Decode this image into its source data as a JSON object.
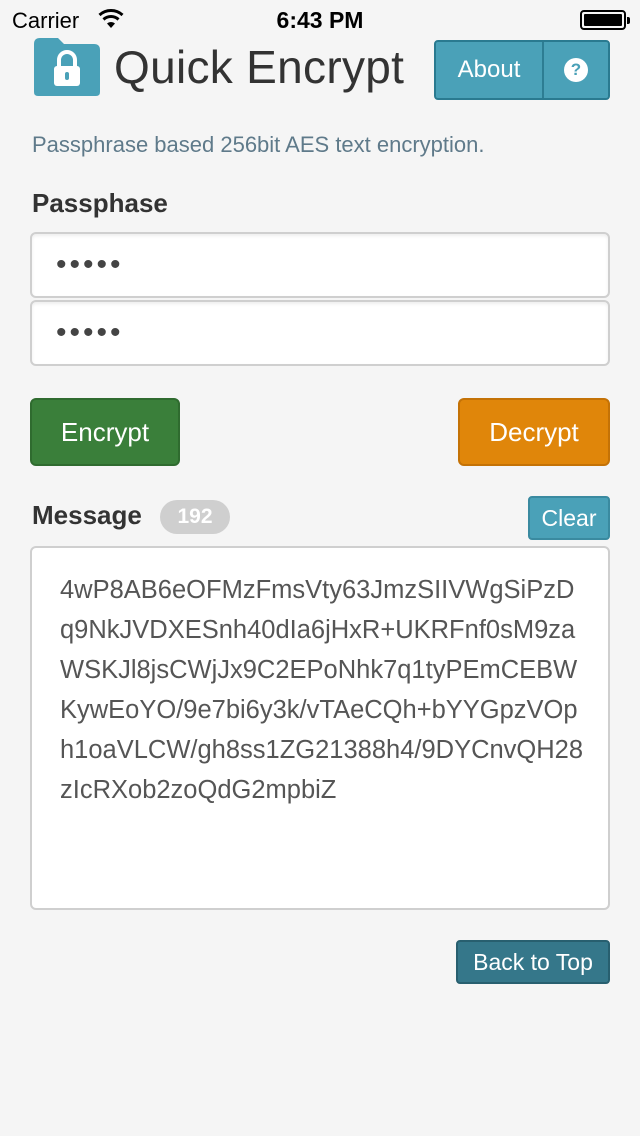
{
  "status_bar": {
    "carrier": "Carrier",
    "time": "6:43 PM",
    "wifi_icon": "wifi-icon",
    "battery_icon": "battery-icon"
  },
  "header": {
    "app_icon": "lock-folder-icon",
    "title": "Quick Encrypt",
    "about_label": "About",
    "help_icon": "question-circle-icon",
    "help_glyph": "?"
  },
  "tagline": "Passphrase based 256bit AES text encryption.",
  "passphrase": {
    "label": "Passphase",
    "field1_value": "•••••",
    "field2_value": "•••••"
  },
  "actions": {
    "encrypt_label": "Encrypt",
    "decrypt_label": "Decrypt"
  },
  "message": {
    "label": "Message",
    "count": "192",
    "clear_label": "Clear",
    "text": "4wP8AB6eOFMzFmsVty63JmzSIIVWgSiPzDq9NkJVDXESnh40dIa6jHxR+UKRFnf0sM9zaWSKJl8jsCWjJx9C2EPoNhk7q1tyPEmCEBWKywEoYO/9e7bi6y3k/vTAeCQh+bYYGpzVOph1oaVLCW/gh8ss1ZG21388h4/9DYCnvQH28zIcRXob2zoQdG2mpbiZ"
  },
  "footer": {
    "back_to_top_label": "Back to Top"
  },
  "colors": {
    "background": "#f5f5f5",
    "info": "#4aa1b8",
    "success": "#3a7f3a",
    "warning": "#e0860a",
    "badge": "#cfcfcf"
  }
}
